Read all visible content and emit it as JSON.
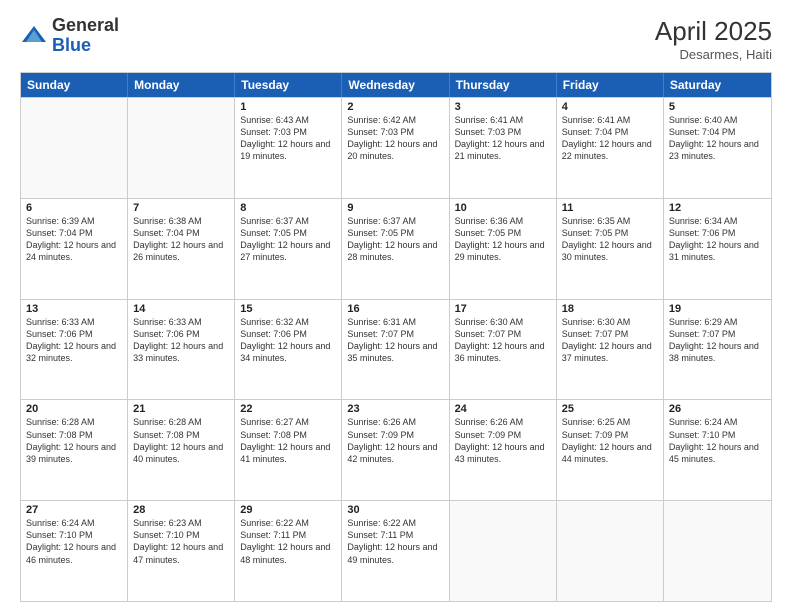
{
  "header": {
    "logo_general": "General",
    "logo_blue": "Blue",
    "month_year": "April 2025",
    "location": "Desarmes, Haiti"
  },
  "days_of_week": [
    "Sunday",
    "Monday",
    "Tuesday",
    "Wednesday",
    "Thursday",
    "Friday",
    "Saturday"
  ],
  "rows": [
    [
      {
        "day": "",
        "info": ""
      },
      {
        "day": "",
        "info": ""
      },
      {
        "day": "1",
        "info": "Sunrise: 6:43 AM\nSunset: 7:03 PM\nDaylight: 12 hours and 19 minutes."
      },
      {
        "day": "2",
        "info": "Sunrise: 6:42 AM\nSunset: 7:03 PM\nDaylight: 12 hours and 20 minutes."
      },
      {
        "day": "3",
        "info": "Sunrise: 6:41 AM\nSunset: 7:03 PM\nDaylight: 12 hours and 21 minutes."
      },
      {
        "day": "4",
        "info": "Sunrise: 6:41 AM\nSunset: 7:04 PM\nDaylight: 12 hours and 22 minutes."
      },
      {
        "day": "5",
        "info": "Sunrise: 6:40 AM\nSunset: 7:04 PM\nDaylight: 12 hours and 23 minutes."
      }
    ],
    [
      {
        "day": "6",
        "info": "Sunrise: 6:39 AM\nSunset: 7:04 PM\nDaylight: 12 hours and 24 minutes."
      },
      {
        "day": "7",
        "info": "Sunrise: 6:38 AM\nSunset: 7:04 PM\nDaylight: 12 hours and 26 minutes."
      },
      {
        "day": "8",
        "info": "Sunrise: 6:37 AM\nSunset: 7:05 PM\nDaylight: 12 hours and 27 minutes."
      },
      {
        "day": "9",
        "info": "Sunrise: 6:37 AM\nSunset: 7:05 PM\nDaylight: 12 hours and 28 minutes."
      },
      {
        "day": "10",
        "info": "Sunrise: 6:36 AM\nSunset: 7:05 PM\nDaylight: 12 hours and 29 minutes."
      },
      {
        "day": "11",
        "info": "Sunrise: 6:35 AM\nSunset: 7:05 PM\nDaylight: 12 hours and 30 minutes."
      },
      {
        "day": "12",
        "info": "Sunrise: 6:34 AM\nSunset: 7:06 PM\nDaylight: 12 hours and 31 minutes."
      }
    ],
    [
      {
        "day": "13",
        "info": "Sunrise: 6:33 AM\nSunset: 7:06 PM\nDaylight: 12 hours and 32 minutes."
      },
      {
        "day": "14",
        "info": "Sunrise: 6:33 AM\nSunset: 7:06 PM\nDaylight: 12 hours and 33 minutes."
      },
      {
        "day": "15",
        "info": "Sunrise: 6:32 AM\nSunset: 7:06 PM\nDaylight: 12 hours and 34 minutes."
      },
      {
        "day": "16",
        "info": "Sunrise: 6:31 AM\nSunset: 7:07 PM\nDaylight: 12 hours and 35 minutes."
      },
      {
        "day": "17",
        "info": "Sunrise: 6:30 AM\nSunset: 7:07 PM\nDaylight: 12 hours and 36 minutes."
      },
      {
        "day": "18",
        "info": "Sunrise: 6:30 AM\nSunset: 7:07 PM\nDaylight: 12 hours and 37 minutes."
      },
      {
        "day": "19",
        "info": "Sunrise: 6:29 AM\nSunset: 7:07 PM\nDaylight: 12 hours and 38 minutes."
      }
    ],
    [
      {
        "day": "20",
        "info": "Sunrise: 6:28 AM\nSunset: 7:08 PM\nDaylight: 12 hours and 39 minutes."
      },
      {
        "day": "21",
        "info": "Sunrise: 6:28 AM\nSunset: 7:08 PM\nDaylight: 12 hours and 40 minutes."
      },
      {
        "day": "22",
        "info": "Sunrise: 6:27 AM\nSunset: 7:08 PM\nDaylight: 12 hours and 41 minutes."
      },
      {
        "day": "23",
        "info": "Sunrise: 6:26 AM\nSunset: 7:09 PM\nDaylight: 12 hours and 42 minutes."
      },
      {
        "day": "24",
        "info": "Sunrise: 6:26 AM\nSunset: 7:09 PM\nDaylight: 12 hours and 43 minutes."
      },
      {
        "day": "25",
        "info": "Sunrise: 6:25 AM\nSunset: 7:09 PM\nDaylight: 12 hours and 44 minutes."
      },
      {
        "day": "26",
        "info": "Sunrise: 6:24 AM\nSunset: 7:10 PM\nDaylight: 12 hours and 45 minutes."
      }
    ],
    [
      {
        "day": "27",
        "info": "Sunrise: 6:24 AM\nSunset: 7:10 PM\nDaylight: 12 hours and 46 minutes."
      },
      {
        "day": "28",
        "info": "Sunrise: 6:23 AM\nSunset: 7:10 PM\nDaylight: 12 hours and 47 minutes."
      },
      {
        "day": "29",
        "info": "Sunrise: 6:22 AM\nSunset: 7:11 PM\nDaylight: 12 hours and 48 minutes."
      },
      {
        "day": "30",
        "info": "Sunrise: 6:22 AM\nSunset: 7:11 PM\nDaylight: 12 hours and 49 minutes."
      },
      {
        "day": "",
        "info": ""
      },
      {
        "day": "",
        "info": ""
      },
      {
        "day": "",
        "info": ""
      }
    ]
  ]
}
